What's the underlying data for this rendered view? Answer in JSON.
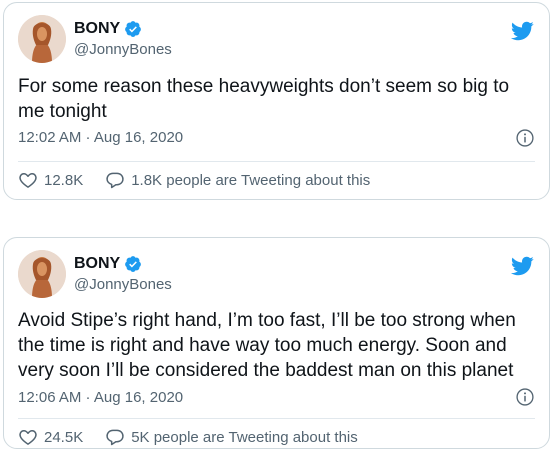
{
  "tweets": [
    {
      "name": "BONY",
      "handle": "@JonnyBones",
      "text": "For some reason these heavyweights don’t seem so big to me tonight",
      "timestamp": "12:02 AM · Aug 16, 2020",
      "likes": "12.8K",
      "conversation": "1.8K people are Tweeting about this",
      "icons": [
        "avatar",
        "verified-icon",
        "twitter-bird-icon",
        "info-icon",
        "heart-icon",
        "reply-bubble-icon"
      ]
    },
    {
      "name": "BONY",
      "handle": "@JonnyBones",
      "text": "Avoid Stipe’s right hand, I’m too fast, I’ll be too strong when the time is right and have way too much energy. Soon and very soon I’ll be considered the baddest man on this planet",
      "timestamp": "12:06 AM · Aug 16, 2020",
      "likes": "24.5K",
      "conversation": "5K people are Tweeting about this",
      "icons": [
        "avatar",
        "verified-icon",
        "twitter-bird-icon",
        "info-icon",
        "heart-icon",
        "reply-bubble-icon"
      ]
    }
  ],
  "colors": {
    "twitter_blue": "#1d9bf0",
    "secondary_text": "#536471",
    "border": "#cfd9de"
  }
}
